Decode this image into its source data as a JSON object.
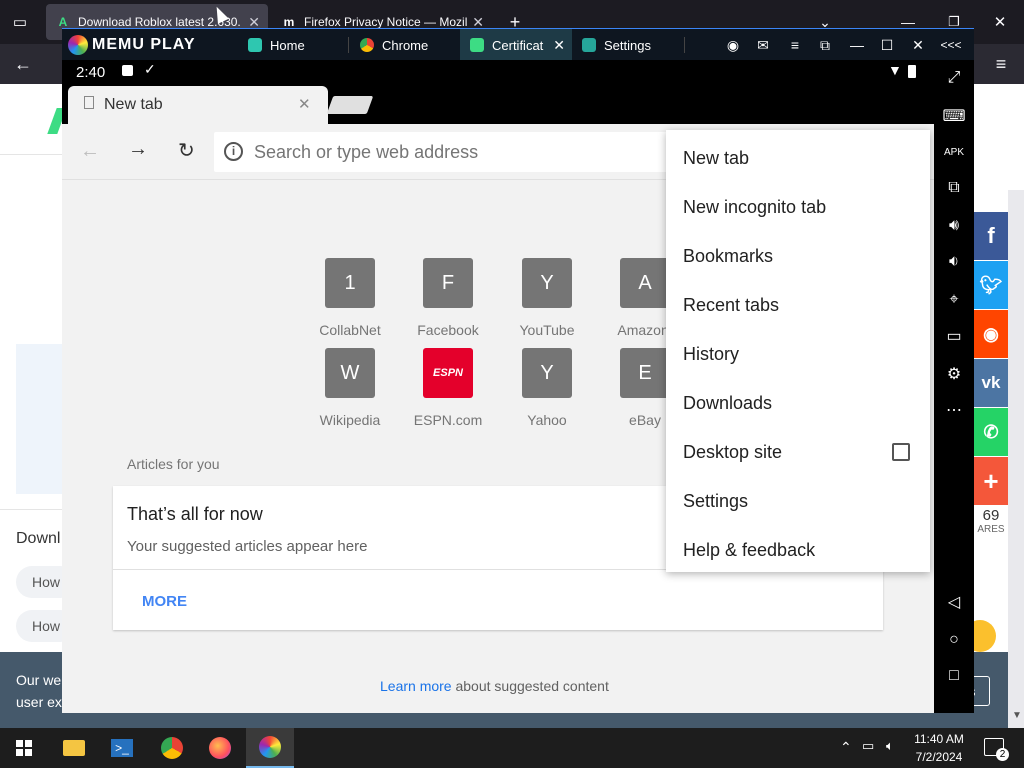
{
  "firefox": {
    "tabs": [
      {
        "title": "Download Roblox latest 2.630.",
        "active": true
      },
      {
        "title": "Firefox Privacy Notice — Mozil",
        "active": false
      }
    ],
    "new_tab_symbol": "+",
    "hamburger_symbol": "≡"
  },
  "background_page": {
    "left_text": "Downl",
    "how_1": "How",
    "how_2": "How",
    "cookie_line_1": "Our we",
    "cookie_line_2": "user ex",
    "share_count": "69",
    "share_label": "ARES",
    "share_buttons": [
      {
        "name": "facebook",
        "glyph": "f",
        "color": "#3b5998"
      },
      {
        "name": "twitter",
        "glyph": "t",
        "color": "#1da1f2"
      },
      {
        "name": "reddit",
        "glyph": "r",
        "color": "#ff4500"
      },
      {
        "name": "vk",
        "glyph": "vk",
        "color": "#4c75a3"
      },
      {
        "name": "whatsapp",
        "glyph": "w",
        "color": "#25d366"
      },
      {
        "name": "more",
        "glyph": "+",
        "color": "#f4573a"
      }
    ]
  },
  "memu": {
    "logo": "MEMU PLAY",
    "tabs": [
      {
        "label": "Home",
        "color": "#2ec7b0"
      },
      {
        "label": "Chrome",
        "color": "#ffffff"
      },
      {
        "label": "Certificat",
        "color": "#3ddc84",
        "active": true
      },
      {
        "label": "Settings",
        "color": "#26a69a"
      }
    ],
    "collapse_symbol": "<<<"
  },
  "android": {
    "time": "2:40",
    "chrome_tab_title": "New tab",
    "omnibox_placeholder": "Search or type web address",
    "tiles_row1": [
      {
        "letter": "1",
        "label": "CollabNet"
      },
      {
        "letter": "F",
        "label": "Facebook"
      },
      {
        "letter": "Y",
        "label": "YouTube"
      },
      {
        "letter": "A",
        "label": "Amazon."
      }
    ],
    "tiles_row2": [
      {
        "letter": "W",
        "label": "Wikipedia"
      },
      {
        "letter": "ESPN",
        "label": "ESPN.com",
        "espn": true
      },
      {
        "letter": "Y",
        "label": "Yahoo"
      },
      {
        "letter": "E",
        "label": "eBay"
      }
    ],
    "articles_header": "Articles for you",
    "card_title": "That’s all for now",
    "card_subtitle": "Your suggested articles appear here",
    "more_button": "MORE",
    "learn_more_link": "Learn more",
    "learn_more_suffix": "about suggested content",
    "menu_items": [
      "New tab",
      "New incognito tab",
      "Bookmarks",
      "Recent tabs",
      "History",
      "Downloads",
      "Desktop site",
      "Settings",
      "Help & feedback"
    ],
    "desktop_site_checked": false
  },
  "taskbar": {
    "time": "11:40 AM",
    "date": "7/2/2024",
    "notification_count": "2"
  }
}
